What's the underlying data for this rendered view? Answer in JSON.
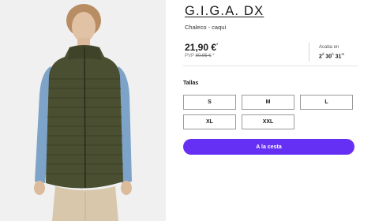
{
  "product": {
    "brand": "G.I.G.A. DX",
    "subtitle": "Chaleco - caqui",
    "price": "21,90 €",
    "price_marker": "*",
    "pvp_label": "PVP",
    "pvp_old": "80,95 €",
    "pvp_marker": "*"
  },
  "offer": {
    "ends_label": "Acaba en",
    "countdown": [
      {
        "value": "2",
        "unit": "d"
      },
      {
        "value": "30",
        "unit": "h"
      },
      {
        "value": "31",
        "unit": "m"
      }
    ]
  },
  "sizes": {
    "label": "Tallas",
    "options": [
      "S",
      "M",
      "L",
      "XL",
      "XXL"
    ]
  },
  "actions": {
    "add_to_cart": "A la cesta"
  },
  "colors": {
    "accent": "#6630f4",
    "vest": "#4a4f31",
    "sleeve": "#7ea3c8",
    "background": "#efefef"
  }
}
